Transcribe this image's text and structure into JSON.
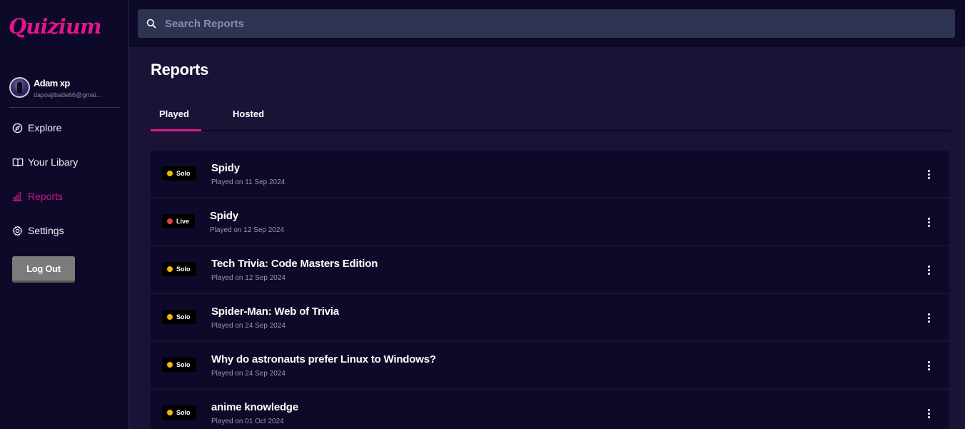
{
  "app": {
    "logo": "Quizium"
  },
  "user": {
    "name": "Adam xp",
    "email": "dapoajibade66@gmai..."
  },
  "nav": [
    {
      "label": "Explore",
      "icon": "compass-icon"
    },
    {
      "label": "Your Libary",
      "icon": "book-icon"
    },
    {
      "label": "Reports",
      "icon": "bar-chart-icon",
      "active": true
    },
    {
      "label": "Settings",
      "icon": "gear-icon"
    }
  ],
  "logout_label": "Log Out",
  "search": {
    "placeholder": "Search Reports",
    "icon": "search-icon"
  },
  "page_title": "Reports",
  "tabs": [
    {
      "label": "Played",
      "active": true
    },
    {
      "label": "Hosted"
    }
  ],
  "reports": [
    {
      "mode": "Solo",
      "title": "Spidy",
      "subtitle": "Played on 11 Sep 2024"
    },
    {
      "mode": "Live",
      "title": "Spidy",
      "subtitle": "Played on 12 Sep 2024"
    },
    {
      "mode": "Solo",
      "title": "Tech Trivia: Code Masters Edition",
      "subtitle": "Played on 12 Sep 2024"
    },
    {
      "mode": "Solo",
      "title": "Spider-Man: Web of Trivia",
      "subtitle": "Played on 24 Sep 2024"
    },
    {
      "mode": "Solo",
      "title": "Why do astronauts prefer Linux to Windows?",
      "subtitle": "Played on 24 Sep 2024"
    },
    {
      "mode": "Solo",
      "title": "anime knowledge",
      "subtitle": "Played on 01 Oct 2024"
    }
  ],
  "colors": {
    "brand": "#e3148c",
    "solo_dot": "#f0b90b",
    "live_dot": "#e53e3e",
    "sidebar_bg": "#0c0a28",
    "main_bg": "#1a1336"
  }
}
